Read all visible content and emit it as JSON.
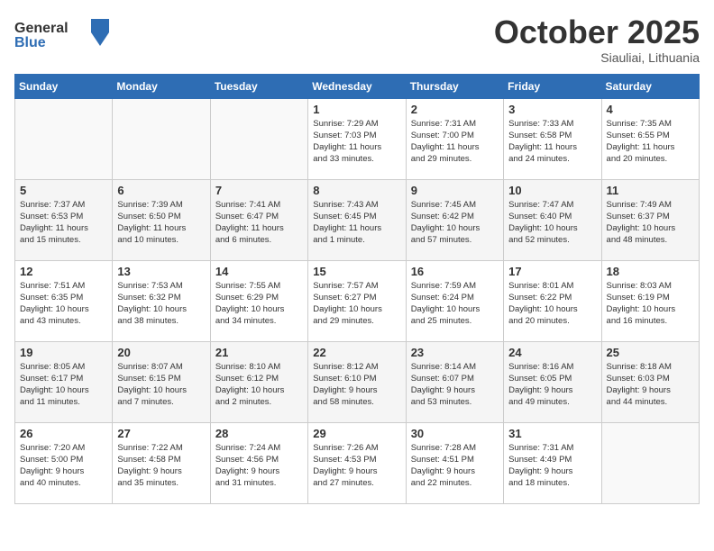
{
  "header": {
    "logo_general": "General",
    "logo_blue": "Blue",
    "month": "October 2025",
    "location": "Siauliai, Lithuania"
  },
  "weekdays": [
    "Sunday",
    "Monday",
    "Tuesday",
    "Wednesday",
    "Thursday",
    "Friday",
    "Saturday"
  ],
  "weeks": [
    [
      {
        "day": "",
        "info": ""
      },
      {
        "day": "",
        "info": ""
      },
      {
        "day": "",
        "info": ""
      },
      {
        "day": "1",
        "info": "Sunrise: 7:29 AM\nSunset: 7:03 PM\nDaylight: 11 hours\nand 33 minutes."
      },
      {
        "day": "2",
        "info": "Sunrise: 7:31 AM\nSunset: 7:00 PM\nDaylight: 11 hours\nand 29 minutes."
      },
      {
        "day": "3",
        "info": "Sunrise: 7:33 AM\nSunset: 6:58 PM\nDaylight: 11 hours\nand 24 minutes."
      },
      {
        "day": "4",
        "info": "Sunrise: 7:35 AM\nSunset: 6:55 PM\nDaylight: 11 hours\nand 20 minutes."
      }
    ],
    [
      {
        "day": "5",
        "info": "Sunrise: 7:37 AM\nSunset: 6:53 PM\nDaylight: 11 hours\nand 15 minutes."
      },
      {
        "day": "6",
        "info": "Sunrise: 7:39 AM\nSunset: 6:50 PM\nDaylight: 11 hours\nand 10 minutes."
      },
      {
        "day": "7",
        "info": "Sunrise: 7:41 AM\nSunset: 6:47 PM\nDaylight: 11 hours\nand 6 minutes."
      },
      {
        "day": "8",
        "info": "Sunrise: 7:43 AM\nSunset: 6:45 PM\nDaylight: 11 hours\nand 1 minute."
      },
      {
        "day": "9",
        "info": "Sunrise: 7:45 AM\nSunset: 6:42 PM\nDaylight: 10 hours\nand 57 minutes."
      },
      {
        "day": "10",
        "info": "Sunrise: 7:47 AM\nSunset: 6:40 PM\nDaylight: 10 hours\nand 52 minutes."
      },
      {
        "day": "11",
        "info": "Sunrise: 7:49 AM\nSunset: 6:37 PM\nDaylight: 10 hours\nand 48 minutes."
      }
    ],
    [
      {
        "day": "12",
        "info": "Sunrise: 7:51 AM\nSunset: 6:35 PM\nDaylight: 10 hours\nand 43 minutes."
      },
      {
        "day": "13",
        "info": "Sunrise: 7:53 AM\nSunset: 6:32 PM\nDaylight: 10 hours\nand 38 minutes."
      },
      {
        "day": "14",
        "info": "Sunrise: 7:55 AM\nSunset: 6:29 PM\nDaylight: 10 hours\nand 34 minutes."
      },
      {
        "day": "15",
        "info": "Sunrise: 7:57 AM\nSunset: 6:27 PM\nDaylight: 10 hours\nand 29 minutes."
      },
      {
        "day": "16",
        "info": "Sunrise: 7:59 AM\nSunset: 6:24 PM\nDaylight: 10 hours\nand 25 minutes."
      },
      {
        "day": "17",
        "info": "Sunrise: 8:01 AM\nSunset: 6:22 PM\nDaylight: 10 hours\nand 20 minutes."
      },
      {
        "day": "18",
        "info": "Sunrise: 8:03 AM\nSunset: 6:19 PM\nDaylight: 10 hours\nand 16 minutes."
      }
    ],
    [
      {
        "day": "19",
        "info": "Sunrise: 8:05 AM\nSunset: 6:17 PM\nDaylight: 10 hours\nand 11 minutes."
      },
      {
        "day": "20",
        "info": "Sunrise: 8:07 AM\nSunset: 6:15 PM\nDaylight: 10 hours\nand 7 minutes."
      },
      {
        "day": "21",
        "info": "Sunrise: 8:10 AM\nSunset: 6:12 PM\nDaylight: 10 hours\nand 2 minutes."
      },
      {
        "day": "22",
        "info": "Sunrise: 8:12 AM\nSunset: 6:10 PM\nDaylight: 9 hours\nand 58 minutes."
      },
      {
        "day": "23",
        "info": "Sunrise: 8:14 AM\nSunset: 6:07 PM\nDaylight: 9 hours\nand 53 minutes."
      },
      {
        "day": "24",
        "info": "Sunrise: 8:16 AM\nSunset: 6:05 PM\nDaylight: 9 hours\nand 49 minutes."
      },
      {
        "day": "25",
        "info": "Sunrise: 8:18 AM\nSunset: 6:03 PM\nDaylight: 9 hours\nand 44 minutes."
      }
    ],
    [
      {
        "day": "26",
        "info": "Sunrise: 7:20 AM\nSunset: 5:00 PM\nDaylight: 9 hours\nand 40 minutes."
      },
      {
        "day": "27",
        "info": "Sunrise: 7:22 AM\nSunset: 4:58 PM\nDaylight: 9 hours\nand 35 minutes."
      },
      {
        "day": "28",
        "info": "Sunrise: 7:24 AM\nSunset: 4:56 PM\nDaylight: 9 hours\nand 31 minutes."
      },
      {
        "day": "29",
        "info": "Sunrise: 7:26 AM\nSunset: 4:53 PM\nDaylight: 9 hours\nand 27 minutes."
      },
      {
        "day": "30",
        "info": "Sunrise: 7:28 AM\nSunset: 4:51 PM\nDaylight: 9 hours\nand 22 minutes."
      },
      {
        "day": "31",
        "info": "Sunrise: 7:31 AM\nSunset: 4:49 PM\nDaylight: 9 hours\nand 18 minutes."
      },
      {
        "day": "",
        "info": ""
      }
    ]
  ]
}
